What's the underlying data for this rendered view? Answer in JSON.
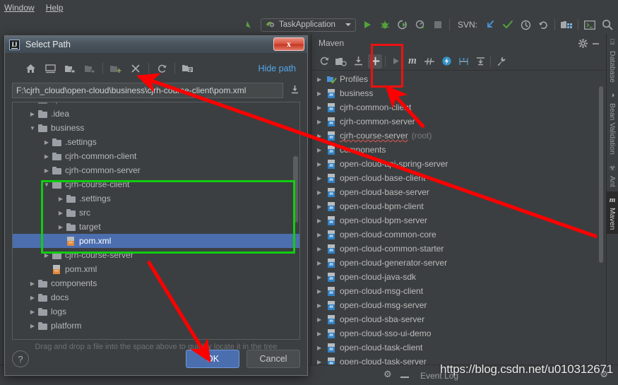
{
  "ide": {
    "menubar": [
      "Window",
      "Help"
    ],
    "toolbar": {
      "run_config": "TaskApplication",
      "icons": [
        "back-arrow-icon",
        "run-icon",
        "debug-icon",
        "run-coverage-icon",
        "profile-icon",
        "stop-icon"
      ],
      "svn_label": "SVN:",
      "svn_icons": [
        "update-icon",
        "commit-icon",
        "history-icon",
        "revert-icon"
      ],
      "right_icons": [
        "project-structure-icon",
        "terminal-icon",
        "search-everywhere-icon"
      ]
    }
  },
  "maven": {
    "title": "Maven",
    "header_icons": [
      "gear-icon",
      "minimize-icon"
    ],
    "toolbar_icons": [
      "reimport-icon",
      "generate-sources-icon",
      "download-sources-icon",
      "add-maven-project-icon",
      "run-icon",
      "execute-goal-icon",
      "toggle-skip-tests-icon",
      "offline-mode-icon",
      "show-dependencies-icon",
      "collapse-all-icon",
      "settings-wrench-icon"
    ],
    "tree": [
      {
        "label": "Profiles",
        "icon": "profiles-icon",
        "indent": 0,
        "expandable": true
      },
      {
        "label": "business",
        "icon": "maven-project-icon",
        "indent": 0,
        "expandable": true
      },
      {
        "label": "cjrh-common-client",
        "icon": "maven-project-icon",
        "indent": 0,
        "expandable": true
      },
      {
        "label": "cjrh-common-server",
        "icon": "maven-project-icon",
        "indent": 0,
        "expandable": true
      },
      {
        "label": "cjrh-course-server",
        "suffix": "(root)",
        "icon": "maven-project-icon",
        "indent": 0,
        "expandable": true,
        "spellcheck_error": true
      },
      {
        "label": "components",
        "icon": "maven-project-icon",
        "indent": 0,
        "expandable": true
      },
      {
        "label": "open-cloud-api-spring-server",
        "icon": "maven-project-icon",
        "indent": 0,
        "expandable": true
      },
      {
        "label": "open-cloud-base-client",
        "icon": "maven-project-icon",
        "indent": 0,
        "expandable": true
      },
      {
        "label": "open-cloud-base-server",
        "icon": "maven-project-icon",
        "indent": 0,
        "expandable": true
      },
      {
        "label": "open-cloud-bpm-client",
        "icon": "maven-project-icon",
        "indent": 0,
        "expandable": true
      },
      {
        "label": "open-cloud-bpm-server",
        "icon": "maven-project-icon",
        "indent": 0,
        "expandable": true
      },
      {
        "label": "open-cloud-common-core",
        "icon": "maven-project-icon",
        "indent": 0,
        "expandable": true
      },
      {
        "label": "open-cloud-common-starter",
        "icon": "maven-project-icon",
        "indent": 0,
        "expandable": true
      },
      {
        "label": "open-cloud-generator-server",
        "icon": "maven-project-icon",
        "indent": 0,
        "expandable": true
      },
      {
        "label": "open-cloud-java-sdk",
        "icon": "maven-project-icon",
        "indent": 0,
        "expandable": true
      },
      {
        "label": "open-cloud-msg-client",
        "icon": "maven-project-icon",
        "indent": 0,
        "expandable": true
      },
      {
        "label": "open-cloud-msg-server",
        "icon": "maven-project-icon",
        "indent": 0,
        "expandable": true
      },
      {
        "label": "open-cloud-sba-server",
        "icon": "maven-project-icon",
        "indent": 0,
        "expandable": true
      },
      {
        "label": "open-cloud-sso-ui-demo",
        "icon": "maven-project-icon",
        "indent": 0,
        "expandable": true
      },
      {
        "label": "open-cloud-task-client",
        "icon": "maven-project-icon",
        "indent": 0,
        "expandable": true
      },
      {
        "label": "open-cloud-task-server",
        "icon": "maven-project-icon",
        "indent": 0,
        "expandable": true
      }
    ]
  },
  "vertical_tabs": [
    {
      "label": "Database",
      "icon": "database-icon",
      "selected": false
    },
    {
      "label": "Bean Validation",
      "icon": "bean-validation-icon",
      "selected": false
    },
    {
      "label": "Ant",
      "icon": "ant-icon",
      "selected": false
    },
    {
      "label": "Maven",
      "icon": "maven-icon",
      "selected": true
    }
  ],
  "statusbar": {
    "event_log": "Event Log",
    "watermark": "https://blog.csdn.net/u010312671",
    "icons": [
      "gear-icon",
      "minimize-icon",
      "settings-gear-icon"
    ]
  },
  "dialog": {
    "title": "Select Path",
    "app_icon": "intellij-idea-icon",
    "close_label": "x",
    "toolbar_icons": [
      "home-icon",
      "desktop-icon",
      "project-folder-icon",
      "module-folder-icon",
      "new-folder-icon",
      "delete-icon",
      "refresh-icon",
      "show-hidden-icon"
    ],
    "hide_path_label": "Hide path",
    "path_value": "F:\\cjrh_cloud\\open-cloud\\business\\cjrh-course-client\\pom.xml",
    "path_dropdown_icon": "recent-paths-icon",
    "tree": [
      {
        "label": "open-cloud",
        "icon": "folder-icon",
        "indent": 1,
        "state": "expanded",
        "clipped": true
      },
      {
        "label": ".idea",
        "icon": "folder-icon",
        "indent": 1,
        "state": "collapsed"
      },
      {
        "label": "business",
        "icon": "folder-icon",
        "indent": 1,
        "state": "expanded"
      },
      {
        "label": ".settings",
        "icon": "folder-icon",
        "indent": 2,
        "state": "collapsed"
      },
      {
        "label": "cjrh-common-client",
        "icon": "folder-icon",
        "indent": 2,
        "state": "collapsed"
      },
      {
        "label": "cjrh-common-server",
        "icon": "folder-icon",
        "indent": 2,
        "state": "collapsed"
      },
      {
        "label": "cjrh-course-client",
        "icon": "folder-icon",
        "indent": 2,
        "state": "expanded"
      },
      {
        "label": ".settings",
        "icon": "folder-icon",
        "indent": 3,
        "state": "collapsed"
      },
      {
        "label": "src",
        "icon": "folder-icon",
        "indent": 3,
        "state": "collapsed"
      },
      {
        "label": "target",
        "icon": "folder-icon",
        "indent": 3,
        "state": "collapsed"
      },
      {
        "label": "pom.xml",
        "icon": "xml-file-icon",
        "indent": 3,
        "state": "leaf",
        "selected": true
      },
      {
        "label": "cjrh-course-server",
        "icon": "folder-icon",
        "indent": 2,
        "state": "collapsed"
      },
      {
        "label": "pom.xml",
        "icon": "xml-file-icon",
        "indent": 2,
        "state": "leaf"
      },
      {
        "label": "components",
        "icon": "folder-icon",
        "indent": 1,
        "state": "collapsed"
      },
      {
        "label": "docs",
        "icon": "folder-icon",
        "indent": 1,
        "state": "collapsed"
      },
      {
        "label": "logs",
        "icon": "folder-icon",
        "indent": 1,
        "state": "collapsed"
      },
      {
        "label": "platform",
        "icon": "folder-icon",
        "indent": 1,
        "state": "collapsed"
      }
    ],
    "dnd_hint": "Drag and drop a file into the space above to quickly locate it in the tree",
    "help_label": "?",
    "ok_label": "OK",
    "cancel_label": "Cancel"
  },
  "annotations": {
    "green_highlight_color": "#11cc11",
    "red_highlight_color": "#ee1111",
    "arrow_color": "#ff0000"
  }
}
